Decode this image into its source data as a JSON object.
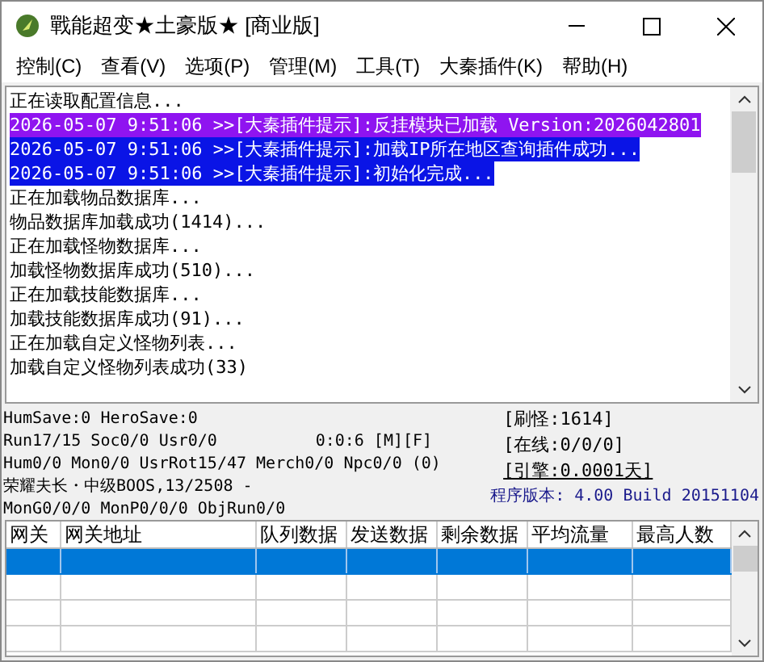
{
  "window": {
    "title": "戰能超变★土豪版★ [商业版]"
  },
  "menu": [
    {
      "label": "控制(C)"
    },
    {
      "label": "查看(V)"
    },
    {
      "label": "选项(P)"
    },
    {
      "label": "管理(M)"
    },
    {
      "label": "工具(T)"
    },
    {
      "label": "大秦插件(K)"
    },
    {
      "label": "帮助(H)"
    }
  ],
  "log": [
    {
      "text": "正在读取配置信息..."
    },
    {
      "text": "2026-05-07 9:51:06 >>[大秦插件提示]:反挂模块已加载 Version:2026042801",
      "color": "#8f14f0"
    },
    {
      "text": "2026-05-07 9:51:06 >>[大秦插件提示]:加载IP所在地区查询插件成功...",
      "color": "#0a14e6"
    },
    {
      "text": "2026-05-07 9:51:06 >>[大秦插件提示]:初始化完成...",
      "color": "#0a14e6"
    },
    {
      "text": "正在加载物品数据库..."
    },
    {
      "text": "物品数据库加载成功(1414)..."
    },
    {
      "text": "正在加载怪物数据库..."
    },
    {
      "text": "加载怪物数据库成功(510)..."
    },
    {
      "text": "正在加载技能数据库..."
    },
    {
      "text": "加载技能数据库成功(91)..."
    },
    {
      "text": "正在加载自定义怪物列表..."
    },
    {
      "text": "加载自定义怪物列表成功(33)"
    }
  ],
  "status": {
    "lines": [
      "HumSave:0 HeroSave:0",
      "Run17/15 Soc0/0 Usr0/0",
      "Hum0/0 Mon0/0 UsrRot15/47 Merch0/0 Npc0/0 (0)",
      "荣耀夫长・中级BOOS,13/2508 -",
      "MonG0/0/0 MonP0/0/0 ObjRun0/0"
    ],
    "timer": "0:0:6 [M][F]",
    "counters": [
      {
        "text": "[刷怪:1614]",
        "kind": "plain"
      },
      {
        "text": "[在线:0/0/0]",
        "kind": "plain"
      },
      {
        "text": "[引擎:0.0001天]",
        "kind": "underlined"
      }
    ],
    "version": "程序版本: 4.00 Build 20151104"
  },
  "table": {
    "columns": [
      "网关",
      "网关地址",
      "队列数据",
      "发送数据",
      "剩余数据",
      "平均流量",
      "最高人数"
    ],
    "rows": [
      {
        "selected": true
      },
      {
        "selected": false
      },
      {
        "selected": false
      },
      {
        "selected": false
      }
    ]
  }
}
